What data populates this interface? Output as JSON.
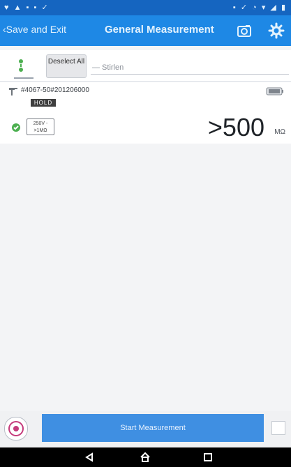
{
  "colors": {
    "status_bar": "#1565c0",
    "title_bar": "#1e88e5",
    "primary_button": "#3f8fe2",
    "ok_green": "#4caf50"
  },
  "header": {
    "back_label": "‹Save and Exit",
    "title": "General Measurement",
    "icons": [
      "camera-icon",
      "gear-icon"
    ]
  },
  "toolbar": {
    "deselect_label": "Deselect All",
    "filter_value": "— Stirlen"
  },
  "probe": {
    "id": "#4067-50#201206000",
    "hold_label": "HOLD",
    "range_label": "250V ->1MΩ",
    "reading": ">500",
    "unit": "MΩ"
  },
  "bottom": {
    "start_label": "Start Measurement",
    "left_icon": "record-icon"
  },
  "navigation": {
    "back": "back-icon",
    "home": "home-icon",
    "recents": "recents-icon"
  }
}
